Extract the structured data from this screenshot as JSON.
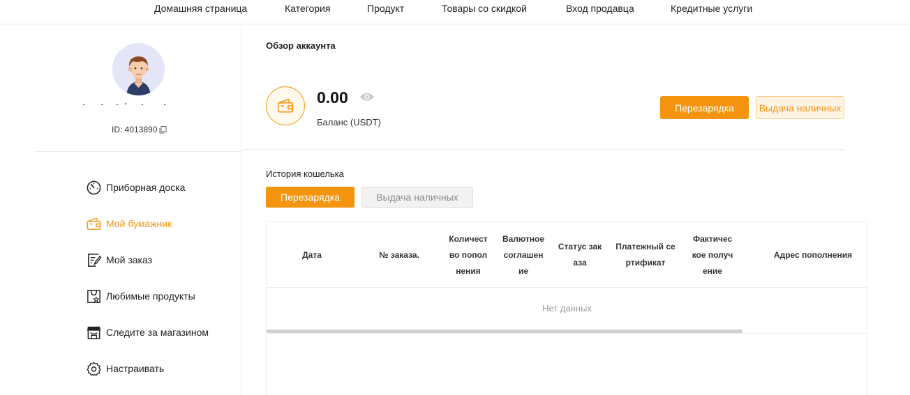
{
  "nav": {
    "items": [
      {
        "label": "Домашняя страница"
      },
      {
        "label": "Категория"
      },
      {
        "label": "Продукт"
      },
      {
        "label": "Товары со скидкой"
      },
      {
        "label": "Вход продавца"
      },
      {
        "label": "Кредитные услуги"
      }
    ]
  },
  "profile": {
    "id_text": "ID: 4013890"
  },
  "sidebar": {
    "items": [
      {
        "label": "Приборная доска",
        "icon": "dashboard-icon"
      },
      {
        "label": "Мой бумажник",
        "icon": "wallet-icon",
        "active": true
      },
      {
        "label": "Мой заказ",
        "icon": "order-icon"
      },
      {
        "label": "Любимые продукты",
        "icon": "favorite-bag-icon"
      },
      {
        "label": "Следите за магазином",
        "icon": "store-icon"
      },
      {
        "label": "Настраивать",
        "icon": "gear-icon"
      }
    ]
  },
  "overview": {
    "title": "Обзор аккаунта",
    "balance": "0.00",
    "balance_label": "Баланс (USDT)",
    "recharge_label": "Перезарядка",
    "cash_label": "Выдача наличных"
  },
  "history": {
    "title": "История кошелька",
    "tabs": [
      {
        "label": "Перезарядка",
        "active": true
      },
      {
        "label": "Выдача наличных",
        "active": false
      }
    ],
    "columns": [
      {
        "label": "Дата"
      },
      {
        "label": "№ заказа."
      },
      {
        "label": "Количест во попол нения"
      },
      {
        "label": "Валютное соглашен ие"
      },
      {
        "label": "Статус зак аза"
      },
      {
        "label": "Платежный се ртификат"
      },
      {
        "label": "Фактичес кое получ ение"
      },
      {
        "label": "Адрес пополнения"
      }
    ],
    "empty_text": "Нет данных"
  },
  "colors": {
    "accent": "#f5950f",
    "accent_light": "#fff4e3",
    "muted": "#999999"
  }
}
